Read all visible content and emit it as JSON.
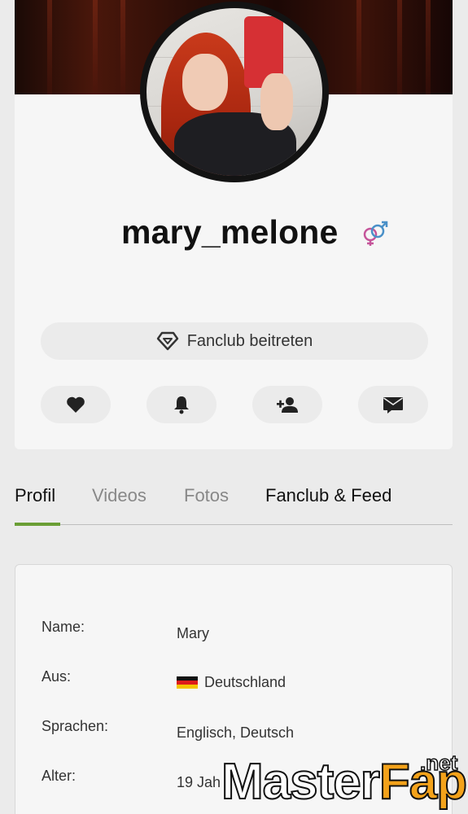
{
  "profile": {
    "username": "mary_melone",
    "fanclub_button_label": "Fanclub beitreten"
  },
  "actions": [
    {
      "name": "like",
      "icon": "heart-icon"
    },
    {
      "name": "notify",
      "icon": "bell-icon"
    },
    {
      "name": "follow",
      "icon": "add-user-icon"
    },
    {
      "name": "message",
      "icon": "envelope-icon"
    }
  ],
  "tabs": [
    {
      "label": "Profil",
      "active": true
    },
    {
      "label": "Videos",
      "active": false
    },
    {
      "label": "Fotos",
      "active": false
    },
    {
      "label": "Fanclub & Feed",
      "active": false
    }
  ],
  "info": {
    "name_label": "Name:",
    "name_value": "Mary",
    "from_label": "Aus:",
    "from_value": "Deutschland",
    "languages_label": "Sprachen:",
    "languages_value": "Englisch, Deutsch",
    "age_label": "Alter:",
    "age_value": "19 Jah"
  },
  "watermark": {
    "part1": "Master",
    "part2": "Fap",
    "tld": ".net"
  },
  "colors": {
    "accent_green": "#6a9e35",
    "gender_male": "#4a90c8",
    "gender_female": "#c5559a",
    "watermark_orange": "#f3a21a"
  }
}
